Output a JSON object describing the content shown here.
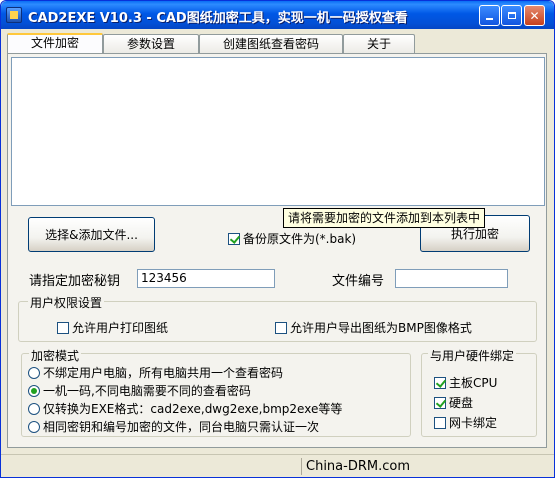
{
  "window": {
    "title": "CAD2EXE V10.3 - CAD图纸加密工具，实现一机一码授权查看"
  },
  "tabs": [
    {
      "label": "文件加密",
      "active": true
    },
    {
      "label": "参数设置",
      "active": false
    },
    {
      "label": "创建图纸查看密码",
      "active": false
    },
    {
      "label": "关于",
      "active": false
    }
  ],
  "tooltip": {
    "text": "请将需要加密的文件添加到本列表中"
  },
  "actions": {
    "add_files": "选择&添加文件...",
    "backup_label": "备份原文件为(*.bak)",
    "backup_checked": true,
    "encrypt": "执行加密"
  },
  "fields": {
    "secret_label": "请指定加密秘钥",
    "secret_value": "123456",
    "file_number_label": "文件编号",
    "file_number_value": ""
  },
  "permissions": {
    "title": "用户权限设置",
    "allow_print": {
      "label": "允许用户打印图纸",
      "checked": false
    },
    "allow_export": {
      "label": "允许用户导出图纸为BMP图像格式",
      "checked": false
    }
  },
  "mode": {
    "title": "加密模式",
    "options": [
      {
        "label": "不绑定用户电脑，所有电脑共用一个查看密码",
        "selected": false
      },
      {
        "label": "一机一码,不同电脑需要不同的查看密码",
        "selected": true
      },
      {
        "label": "仅转换为EXE格式：cad2exe,dwg2exe,bmp2exe等等",
        "selected": false
      },
      {
        "label": "相同密钥和编号加密的文件，同台电脑只需认证一次",
        "selected": false
      }
    ]
  },
  "hardware": {
    "title": "与用户硬件绑定",
    "items": [
      {
        "label": "主板CPU",
        "checked": true
      },
      {
        "label": "硬盘",
        "checked": true
      },
      {
        "label": "网卡绑定",
        "checked": false
      }
    ]
  },
  "status": {
    "text": "China-DRM.com"
  },
  "colors": {
    "titlebar": "#0058e6",
    "accent_check": "#21a121",
    "tab_highlight": "#ffc83c"
  }
}
